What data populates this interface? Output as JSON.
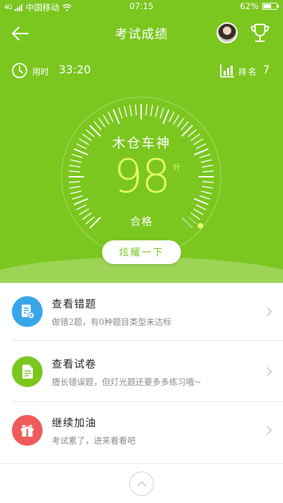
{
  "status_bar": {
    "signal": "4G",
    "carrier": "中国移动",
    "time": "07:15",
    "battery_percent": "62%",
    "battery_level": 0.62
  },
  "navbar": {
    "title": "考试成绩"
  },
  "stats": {
    "time_label": "用时",
    "time_value": "33:20",
    "rank_label": "排名",
    "rank_value": "7"
  },
  "score": {
    "title": "木仓车神",
    "value": "98",
    "unit": "分",
    "status": "合格",
    "fraction": 0.98
  },
  "share_button": "炫耀一下",
  "menu": [
    {
      "title": "查看错题",
      "desc": "做错2题，有0种题目类型未达标",
      "icon": "wrong-questions-icon",
      "color": "#3aa6ea"
    },
    {
      "title": "查看试卷",
      "desc": "擅长错误题，但灯光题还要多多练习哦~",
      "icon": "exam-paper-icon",
      "color": "#7bc61f"
    },
    {
      "title": "继续加油",
      "desc": "考试累了，进来看看吧",
      "icon": "gift-icon",
      "color": "#ef5b5b"
    }
  ],
  "colors": {
    "brand_green": "#7bc61f",
    "score_yellow": "#e6f96b"
  }
}
